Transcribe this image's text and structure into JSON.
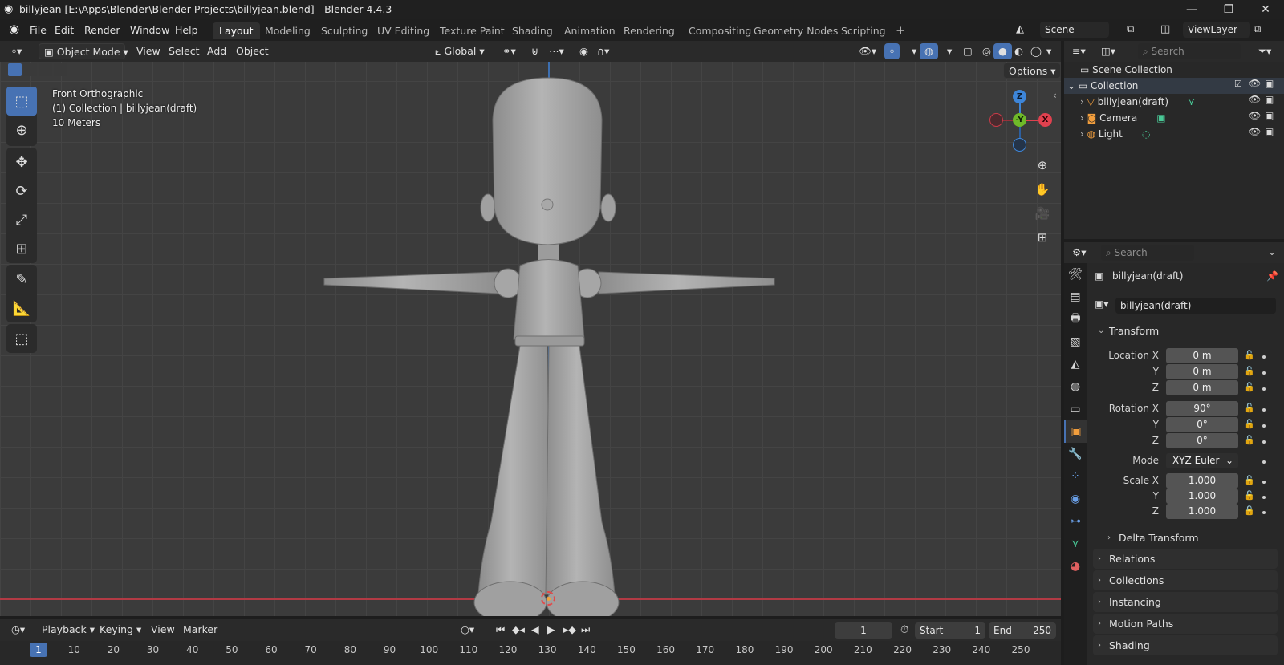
{
  "window": {
    "title": "billyjean [E:\\Apps\\Blender\\Blender Projects\\billyjean.blend] - Blender 4.4.3",
    "controls": [
      "—",
      "❐",
      "✕"
    ]
  },
  "menu": [
    "File",
    "Edit",
    "Render",
    "Window",
    "Help"
  ],
  "workspaces": {
    "tabs": [
      "Layout",
      "Modeling",
      "Sculpting",
      "UV Editing",
      "Texture Paint",
      "Shading",
      "Animation",
      "Rendering",
      "Compositing",
      "Geometry Nodes",
      "Scripting"
    ],
    "active": "Layout",
    "add": "+"
  },
  "scene": {
    "name": "Scene",
    "view_layer": "ViewLayer"
  },
  "viewport": {
    "mode": "Object Mode",
    "menus": [
      "View",
      "Select",
      "Add",
      "Object"
    ],
    "orientation": "Global",
    "options_label": "Options",
    "overlay": {
      "view_name": "Front Orthographic",
      "collection_line": "(1) Collection | billyjean(draft)",
      "scale": "10 Meters"
    },
    "gizmo": {
      "z": "Z",
      "y": "-Y",
      "x": "X"
    },
    "accent_colors": {
      "x": "#e0414f",
      "y": "#6fb929",
      "z": "#3d85d8",
      "active_tool": "#4772b3"
    }
  },
  "timeline": {
    "menus": [
      "Playback",
      "Keying",
      "View",
      "Marker"
    ],
    "current_frame": "1",
    "start_label": "Start",
    "start": "1",
    "end_label": "End",
    "end": "250",
    "ticks": [
      "1",
      "10",
      "20",
      "30",
      "40",
      "50",
      "60",
      "70",
      "80",
      "90",
      "100",
      "110",
      "120",
      "130",
      "140",
      "150",
      "160",
      "170",
      "180",
      "190",
      "200",
      "210",
      "220",
      "230",
      "240",
      "250"
    ]
  },
  "outliner": {
    "search_placeholder": "Search",
    "root": "Scene Collection",
    "collection": "Collection",
    "items": [
      {
        "name": "billyjean(draft)",
        "icon": "mesh-icon"
      },
      {
        "name": "Camera",
        "icon": "camera-icon"
      },
      {
        "name": "Light",
        "icon": "light-icon"
      }
    ]
  },
  "properties": {
    "search_placeholder": "Search",
    "object_name": "billyjean(draft)",
    "object_field": "billyjean(draft)",
    "transform_label": "Transform",
    "location": {
      "label": "Location X",
      "x": "0 m",
      "y": "0 m",
      "z": "0 m"
    },
    "rotation": {
      "label": "Rotation X",
      "x": "90°",
      "y": "0°",
      "z": "0°"
    },
    "mode": {
      "label": "Mode",
      "value": "XYZ Euler"
    },
    "scale": {
      "label": "Scale X",
      "x": "1.000",
      "y": "1.000",
      "z": "1.000"
    },
    "axis_labels": {
      "y": "Y",
      "z": "Z"
    },
    "delta_transform": "Delta Transform",
    "panels": [
      "Relations",
      "Collections",
      "Instancing",
      "Motion Paths",
      "Shading"
    ]
  }
}
